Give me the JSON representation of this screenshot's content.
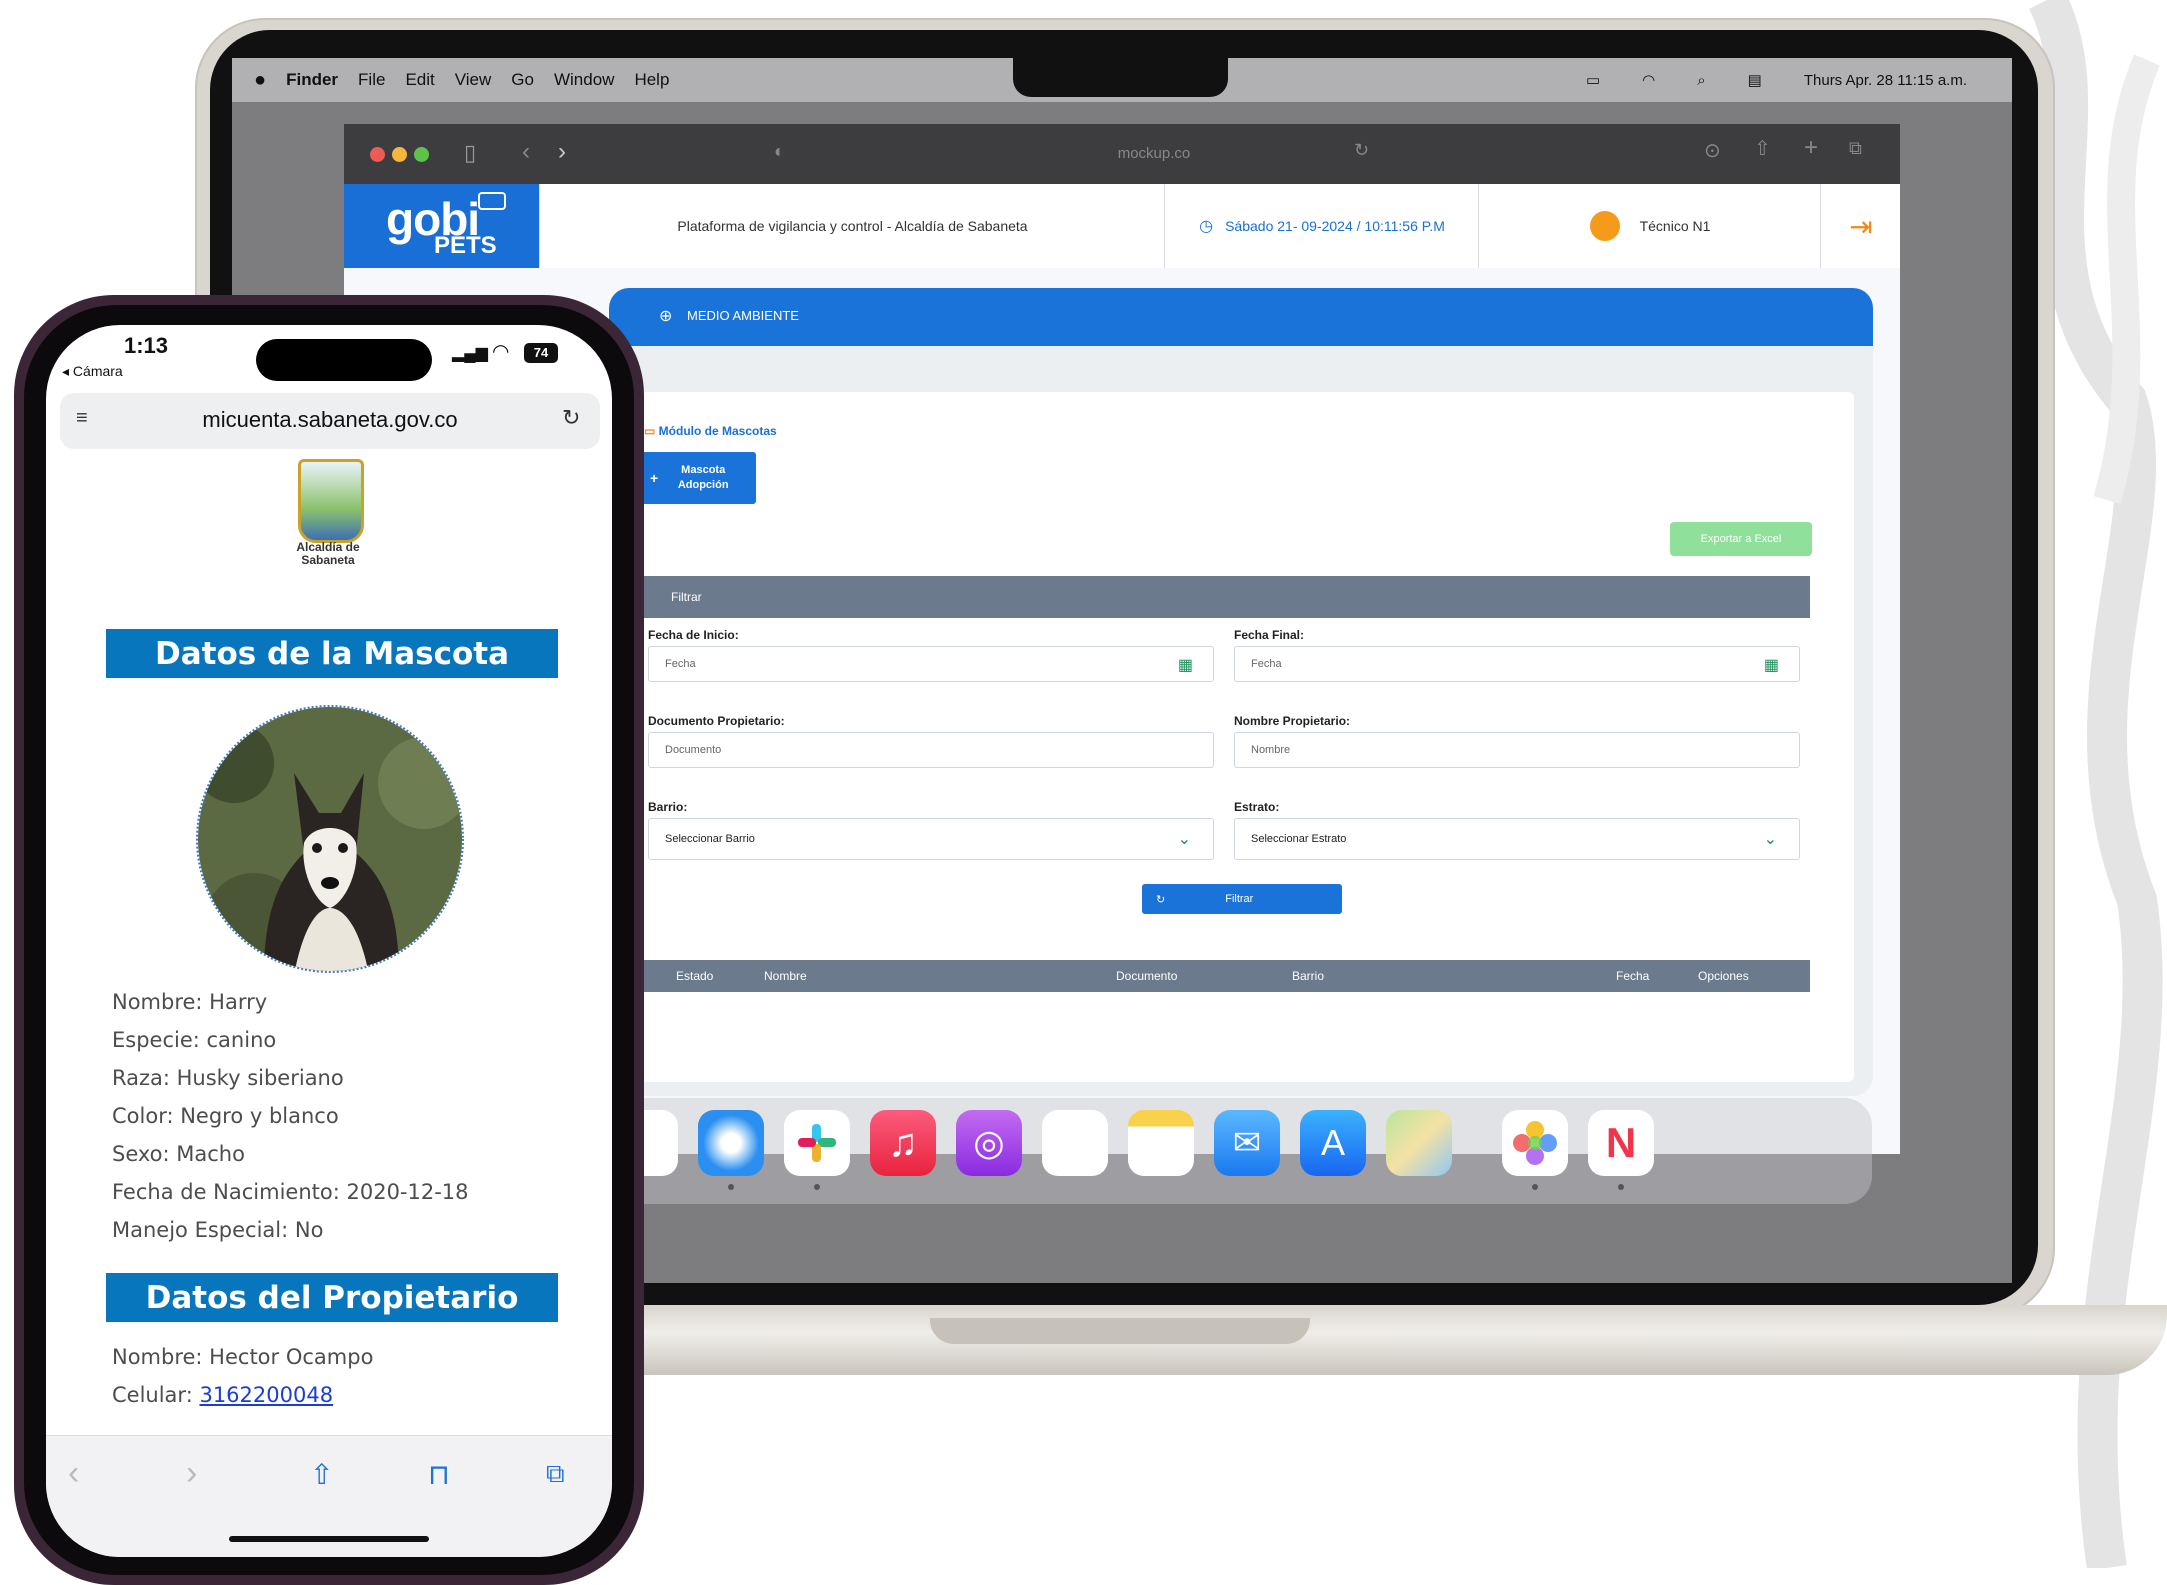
{
  "laptop": {
    "menubar": {
      "app": "Finder",
      "menus": [
        "File",
        "Edit",
        "View",
        "Go",
        "Window",
        "Help"
      ],
      "datetime": "Thurs Apr. 28 11:15 a.m."
    },
    "browser": {
      "url": "mockup.co"
    },
    "app": {
      "logo_main": "gobi",
      "logo_sub": "PETS",
      "platform_title": "Plataforma de vigilancia y control - Alcaldía de Sabaneta",
      "datetime": "Sábado 21- 09-2024 / 10:11:56 P.M",
      "user": "Técnico N1",
      "section_title": "MEDIO AMBIENTE",
      "module_title": "Módulo de Mascotas",
      "new_button": "Mascota Adopción",
      "export_button": "Exportar a Excel",
      "filter_header": "Filtrar",
      "filters": {
        "start_date_label": "Fecha de Inicio:",
        "start_date_placeholder": "Fecha",
        "end_date_label": "Fecha Final:",
        "end_date_placeholder": "Fecha",
        "doc_label": "Documento Propietario:",
        "doc_placeholder": "Documento",
        "name_label": "Nombre Propietario:",
        "name_placeholder": "Nombre",
        "barrio_label": "Barrio:",
        "barrio_value": "Seleccionar Barrio",
        "estrato_label": "Estrato:",
        "estrato_value": "Seleccionar Estrato",
        "filter_button": "Filtrar"
      },
      "table_columns": [
        "Estado",
        "Nombre",
        "Documento",
        "Barrio",
        "Fecha",
        "Opciones"
      ]
    },
    "dock_icons": [
      "safari-icon",
      "slack-icon",
      "music-icon",
      "podcasts-icon",
      "reminders-icon",
      "notes-icon",
      "mail-icon",
      "app-store-icon",
      "maps-icon",
      "photos-icon",
      "news-icon"
    ]
  },
  "phone": {
    "time": "1:13",
    "back_label": "◂ Cámara",
    "battery": "74",
    "url": "micuenta.sabaneta.gov.co",
    "logo_text": "Alcaldía de Sabaneta",
    "pet_section": "Datos de la Mascota",
    "pet_fields": [
      "Nombre: Harry",
      "Especie: canino",
      "Raza: Husky siberiano",
      "Color: Negro y blanco",
      "Sexo: Macho",
      "Fecha de Nacimiento: 2020-12-18",
      "Manejo Especial: No"
    ],
    "owner_section": "Datos del Propietario",
    "owner_name": "Nombre: Hector Ocampo",
    "owner_phone_label": "Celular: ",
    "owner_phone": "3162200048"
  },
  "colors": {
    "brand_blue": "#1a73d8",
    "section_blue": "#0876bd",
    "export_green": "#8fe09a",
    "phone_frame": "#3b2638"
  }
}
